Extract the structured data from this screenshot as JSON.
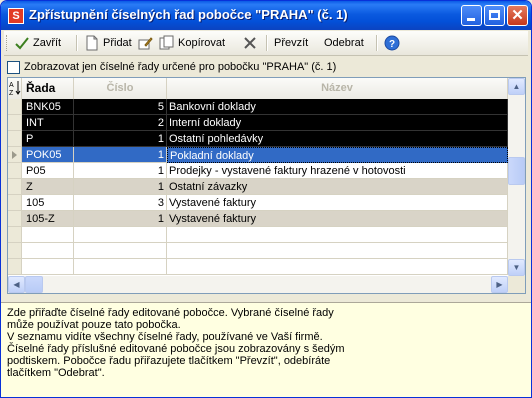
{
  "window": {
    "title": "Zpřístupnění číselných řad pobočce \"PRAHA\" (č. 1)",
    "app_icon_letter": "S",
    "close_glyph": "✕"
  },
  "toolbar": {
    "close_label": "Zavřít",
    "add_label": "Přidat",
    "copy_label": "Kopírovat",
    "take_label": "Převzít",
    "remove_label": "Odebrat",
    "help_glyph": "?"
  },
  "filter": {
    "checkbox_label": "Zobrazovat jen číselné řady určené pro pobočku \"PRAHA\" (č. 1)",
    "checked": false
  },
  "grid": {
    "columns": {
      "rada": "Řada",
      "cislo": "Číslo",
      "nazev": "Název"
    },
    "rows": [
      {
        "rada": "BNK05",
        "cislo": "5",
        "nazev": "Bankovní doklady",
        "style": "black"
      },
      {
        "rada": "INT",
        "cislo": "2",
        "nazev": "Interní doklady",
        "style": "black"
      },
      {
        "rada": "P",
        "cislo": "1",
        "nazev": "Ostatní pohledávky",
        "style": "black"
      },
      {
        "rada": "POK05",
        "cislo": "1",
        "nazev": "Pokladní doklady",
        "style": "sel"
      },
      {
        "rada": "P05",
        "cislo": "1",
        "nazev": "Prodejky - vystavené faktury hrazené v hotovosti",
        "style": "white"
      },
      {
        "rada": "Z",
        "cislo": "1",
        "nazev": "Ostatní závazky",
        "style": "gray"
      },
      {
        "rada": "105",
        "cislo": "3",
        "nazev": "Vystavené faktury",
        "style": "white"
      },
      {
        "rada": "105-Z",
        "cislo": "1",
        "nazev": "Vystavené faktury",
        "style": "gray"
      },
      {
        "rada": "",
        "cislo": "",
        "nazev": "",
        "style": "white"
      },
      {
        "rada": "",
        "cislo": "",
        "nazev": "",
        "style": "white"
      },
      {
        "rada": "",
        "cislo": "",
        "nazev": "",
        "style": "white"
      }
    ],
    "colors": {
      "black_row": "#000000",
      "gray_row": "#d9d4c8",
      "selected_row": "#316ac5"
    }
  },
  "info": {
    "lines": [
      "Zde přiřaďte číselné řady editované pobočce. Vybrané číselné řady",
      "může používat pouze tato pobočka.",
      "V seznamu vidíte všechny číselné řady, používané ve Vaší firmě.",
      "Číselné řady příslušné editované pobočce jsou zobrazovány s šedým",
      "podtiskem. Pobočce řadu přiřazujete tlačítkem \"Převzít\", odebíráte",
      "tlačítkem \"Odebrat\"."
    ]
  }
}
